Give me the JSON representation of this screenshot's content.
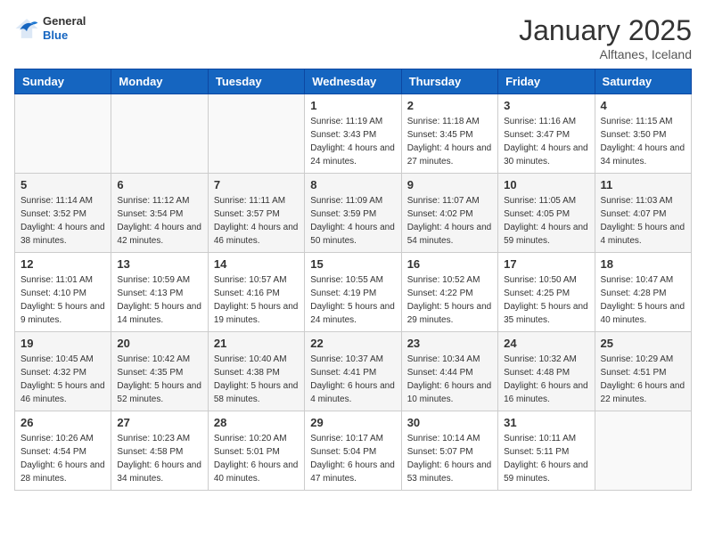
{
  "logo": {
    "general": "General",
    "blue": "Blue"
  },
  "title": "January 2025",
  "location": "Alftanes, Iceland",
  "days_of_week": [
    "Sunday",
    "Monday",
    "Tuesday",
    "Wednesday",
    "Thursday",
    "Friday",
    "Saturday"
  ],
  "weeks": [
    [
      {
        "day": "",
        "info": ""
      },
      {
        "day": "",
        "info": ""
      },
      {
        "day": "",
        "info": ""
      },
      {
        "day": "1",
        "info": "Sunrise: 11:19 AM\nSunset: 3:43 PM\nDaylight: 4 hours and 24 minutes."
      },
      {
        "day": "2",
        "info": "Sunrise: 11:18 AM\nSunset: 3:45 PM\nDaylight: 4 hours and 27 minutes."
      },
      {
        "day": "3",
        "info": "Sunrise: 11:16 AM\nSunset: 3:47 PM\nDaylight: 4 hours and 30 minutes."
      },
      {
        "day": "4",
        "info": "Sunrise: 11:15 AM\nSunset: 3:50 PM\nDaylight: 4 hours and 34 minutes."
      }
    ],
    [
      {
        "day": "5",
        "info": "Sunrise: 11:14 AM\nSunset: 3:52 PM\nDaylight: 4 hours and 38 minutes."
      },
      {
        "day": "6",
        "info": "Sunrise: 11:12 AM\nSunset: 3:54 PM\nDaylight: 4 hours and 42 minutes."
      },
      {
        "day": "7",
        "info": "Sunrise: 11:11 AM\nSunset: 3:57 PM\nDaylight: 4 hours and 46 minutes."
      },
      {
        "day": "8",
        "info": "Sunrise: 11:09 AM\nSunset: 3:59 PM\nDaylight: 4 hours and 50 minutes."
      },
      {
        "day": "9",
        "info": "Sunrise: 11:07 AM\nSunset: 4:02 PM\nDaylight: 4 hours and 54 minutes."
      },
      {
        "day": "10",
        "info": "Sunrise: 11:05 AM\nSunset: 4:05 PM\nDaylight: 4 hours and 59 minutes."
      },
      {
        "day": "11",
        "info": "Sunrise: 11:03 AM\nSunset: 4:07 PM\nDaylight: 5 hours and 4 minutes."
      }
    ],
    [
      {
        "day": "12",
        "info": "Sunrise: 11:01 AM\nSunset: 4:10 PM\nDaylight: 5 hours and 9 minutes."
      },
      {
        "day": "13",
        "info": "Sunrise: 10:59 AM\nSunset: 4:13 PM\nDaylight: 5 hours and 14 minutes."
      },
      {
        "day": "14",
        "info": "Sunrise: 10:57 AM\nSunset: 4:16 PM\nDaylight: 5 hours and 19 minutes."
      },
      {
        "day": "15",
        "info": "Sunrise: 10:55 AM\nSunset: 4:19 PM\nDaylight: 5 hours and 24 minutes."
      },
      {
        "day": "16",
        "info": "Sunrise: 10:52 AM\nSunset: 4:22 PM\nDaylight: 5 hours and 29 minutes."
      },
      {
        "day": "17",
        "info": "Sunrise: 10:50 AM\nSunset: 4:25 PM\nDaylight: 5 hours and 35 minutes."
      },
      {
        "day": "18",
        "info": "Sunrise: 10:47 AM\nSunset: 4:28 PM\nDaylight: 5 hours and 40 minutes."
      }
    ],
    [
      {
        "day": "19",
        "info": "Sunrise: 10:45 AM\nSunset: 4:32 PM\nDaylight: 5 hours and 46 minutes."
      },
      {
        "day": "20",
        "info": "Sunrise: 10:42 AM\nSunset: 4:35 PM\nDaylight: 5 hours and 52 minutes."
      },
      {
        "day": "21",
        "info": "Sunrise: 10:40 AM\nSunset: 4:38 PM\nDaylight: 5 hours and 58 minutes."
      },
      {
        "day": "22",
        "info": "Sunrise: 10:37 AM\nSunset: 4:41 PM\nDaylight: 6 hours and 4 minutes."
      },
      {
        "day": "23",
        "info": "Sunrise: 10:34 AM\nSunset: 4:44 PM\nDaylight: 6 hours and 10 minutes."
      },
      {
        "day": "24",
        "info": "Sunrise: 10:32 AM\nSunset: 4:48 PM\nDaylight: 6 hours and 16 minutes."
      },
      {
        "day": "25",
        "info": "Sunrise: 10:29 AM\nSunset: 4:51 PM\nDaylight: 6 hours and 22 minutes."
      }
    ],
    [
      {
        "day": "26",
        "info": "Sunrise: 10:26 AM\nSunset: 4:54 PM\nDaylight: 6 hours and 28 minutes."
      },
      {
        "day": "27",
        "info": "Sunrise: 10:23 AM\nSunset: 4:58 PM\nDaylight: 6 hours and 34 minutes."
      },
      {
        "day": "28",
        "info": "Sunrise: 10:20 AM\nSunset: 5:01 PM\nDaylight: 6 hours and 40 minutes."
      },
      {
        "day": "29",
        "info": "Sunrise: 10:17 AM\nSunset: 5:04 PM\nDaylight: 6 hours and 47 minutes."
      },
      {
        "day": "30",
        "info": "Sunrise: 10:14 AM\nSunset: 5:07 PM\nDaylight: 6 hours and 53 minutes."
      },
      {
        "day": "31",
        "info": "Sunrise: 10:11 AM\nSunset: 5:11 PM\nDaylight: 6 hours and 59 minutes."
      },
      {
        "day": "",
        "info": ""
      }
    ]
  ]
}
